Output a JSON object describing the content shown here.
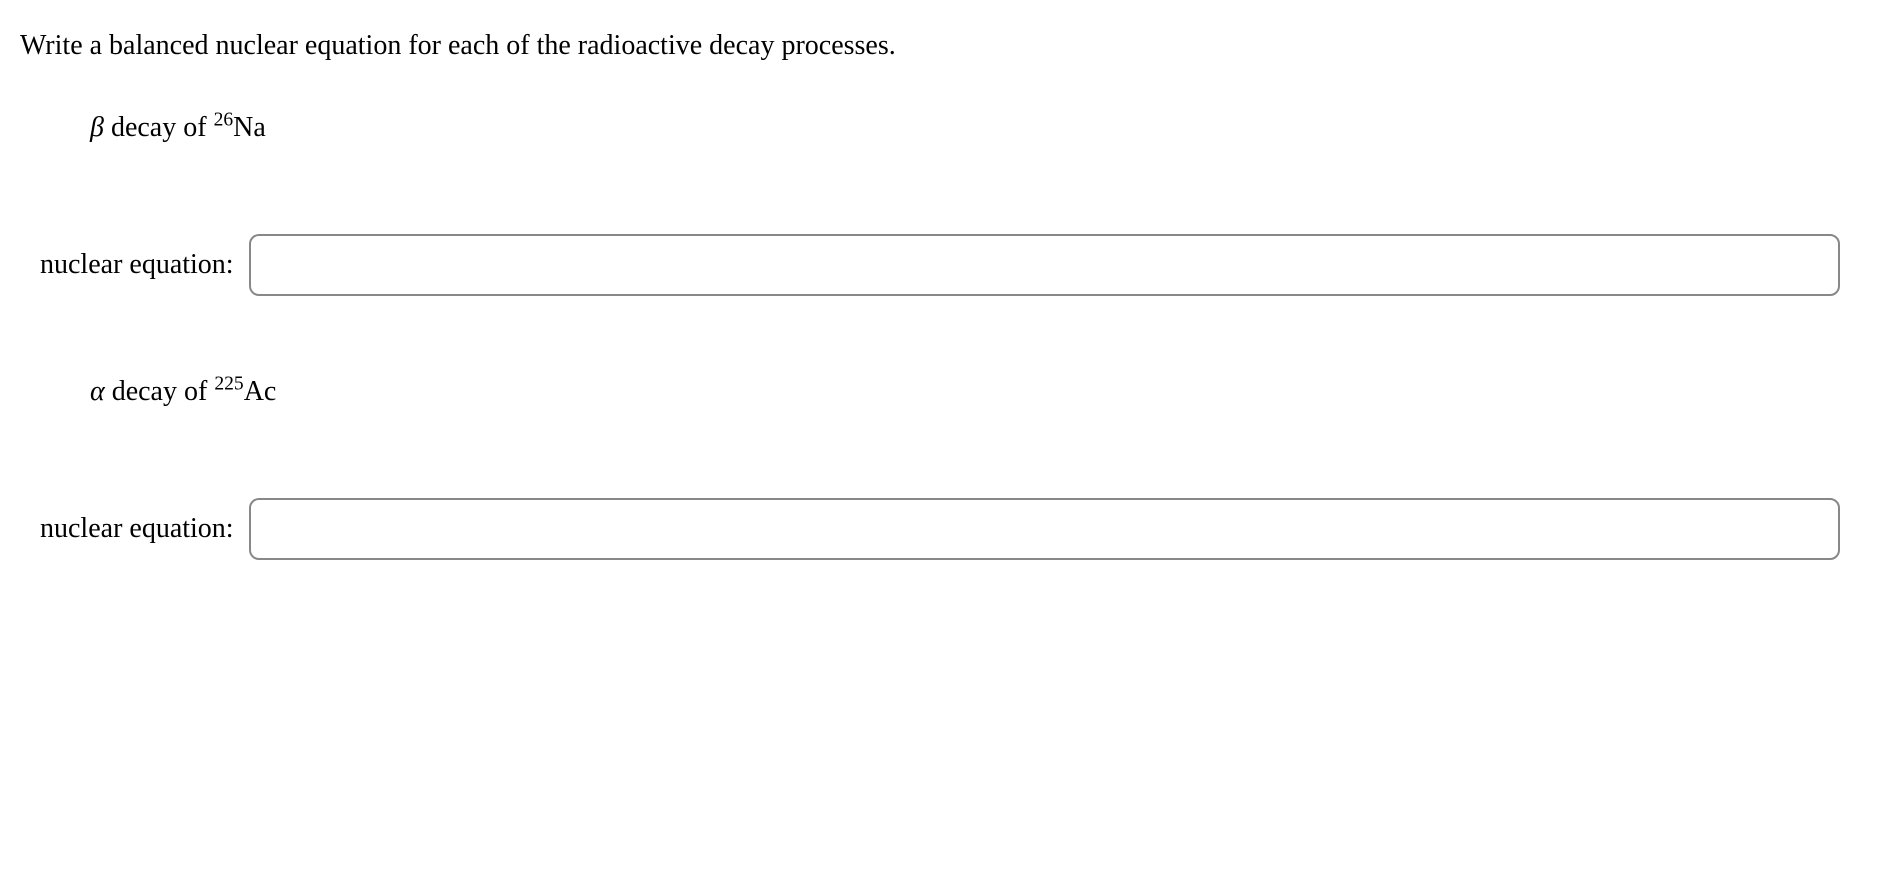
{
  "instruction": "Write a balanced nuclear equation for each of the radioactive decay processes.",
  "problems": [
    {
      "decay_symbol": "β",
      "decay_text_prefix": " decay of ",
      "isotope_mass": "26",
      "isotope_symbol": "Na",
      "input_label": "nuclear equation:",
      "input_value": ""
    },
    {
      "decay_symbol": "α",
      "decay_text_prefix": " decay of ",
      "isotope_mass": "225",
      "isotope_symbol": "Ac",
      "input_label": "nuclear equation:",
      "input_value": ""
    }
  ]
}
